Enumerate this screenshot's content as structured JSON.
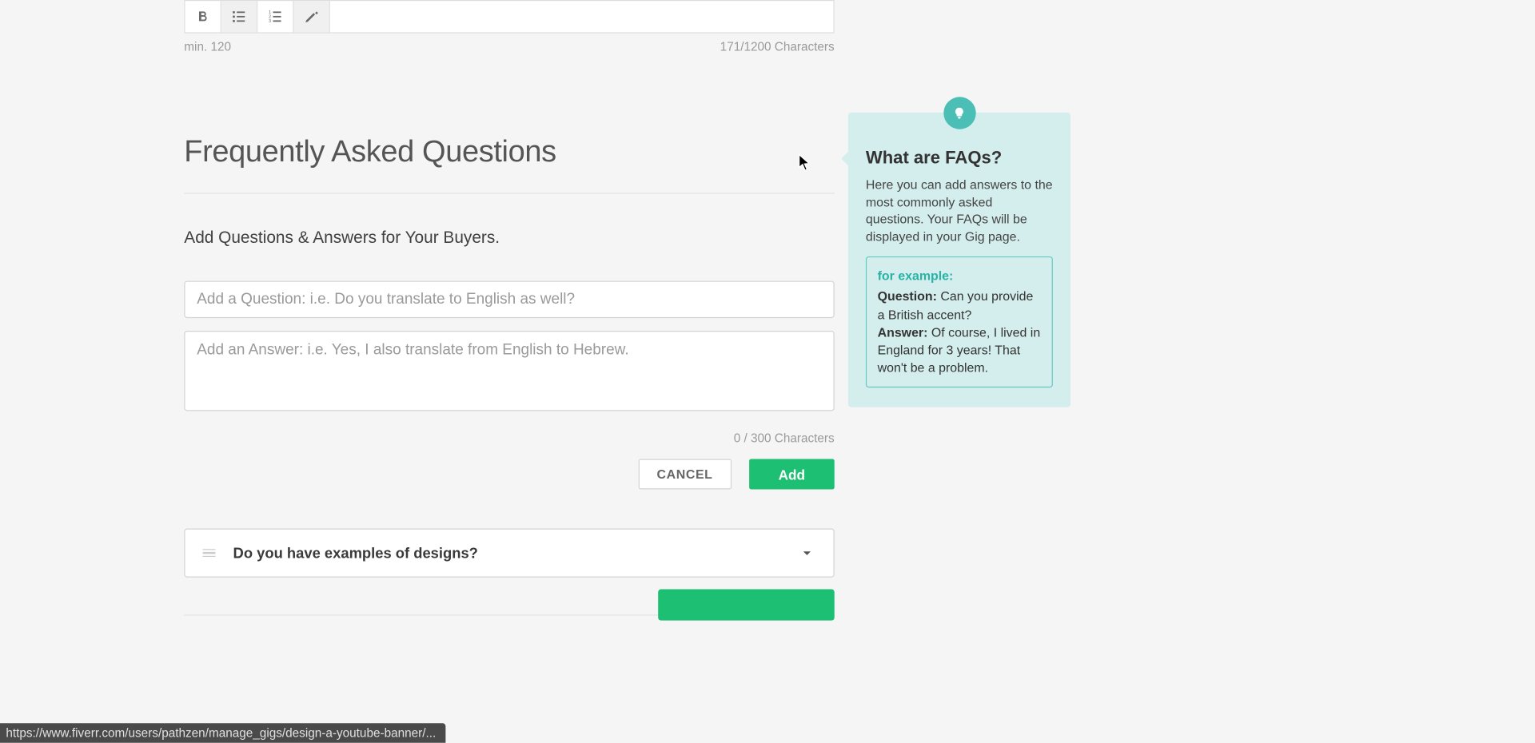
{
  "editor": {
    "min_label": "min. 120",
    "char_counter": "171/1200 Characters"
  },
  "faq": {
    "heading": "Frequently Asked Questions",
    "subheading": "Add Questions & Answers for Your Buyers.",
    "question_placeholder": "Add a Question: i.e. Do you translate to English as well?",
    "answer_placeholder": "Add an Answer: i.e. Yes, I also translate from English to Hebrew.",
    "answer_counter": "0 / 300 Characters",
    "cancel_label": "CANCEL",
    "add_label": "Add",
    "items": [
      {
        "question": "Do you have examples of designs?"
      }
    ]
  },
  "tip": {
    "title": "What are FAQs?",
    "body": "Here you can add answers to the most commonly asked questions. Your FAQs will be displayed in your Gig page.",
    "example_label": "for example:",
    "q_label": "Question:",
    "q_text": "Can you provide a British accent?",
    "a_label": "Answer:",
    "a_text": "Of course, I lived in England for 3 years! That won't be a problem."
  },
  "status_url": "https://www.fiverr.com/users/pathzen/manage_gigs/design-a-youtube-banner/..."
}
